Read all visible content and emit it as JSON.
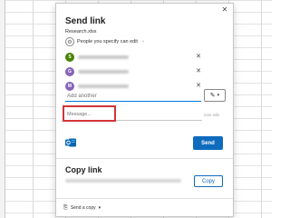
{
  "dialog": {
    "title": "Send link",
    "file_name": "Research.xlsx",
    "permission": "People you specify can edit",
    "recipients": [
      {
        "initial": "S",
        "color": "#498205"
      },
      {
        "initial": "G",
        "color": "#8764b8"
      },
      {
        "initial": "M",
        "color": "#8764b8"
      }
    ],
    "add_another_placeholder": "Add another",
    "message_placeholder": "Message...",
    "cant_edit_label": "Can edit",
    "send_label": "Send",
    "copy_link_title": "Copy link",
    "copy_label": "Copy",
    "send_copy_label": "Send a copy"
  },
  "colors": {
    "accent": "#0f6cbd",
    "highlight_box": "#d13438"
  },
  "icons": {
    "close": "close-icon",
    "permission": "people-icon",
    "edit": "pencil-icon",
    "outlook": "outlook-icon",
    "send_copy": "paperclip-icon"
  }
}
